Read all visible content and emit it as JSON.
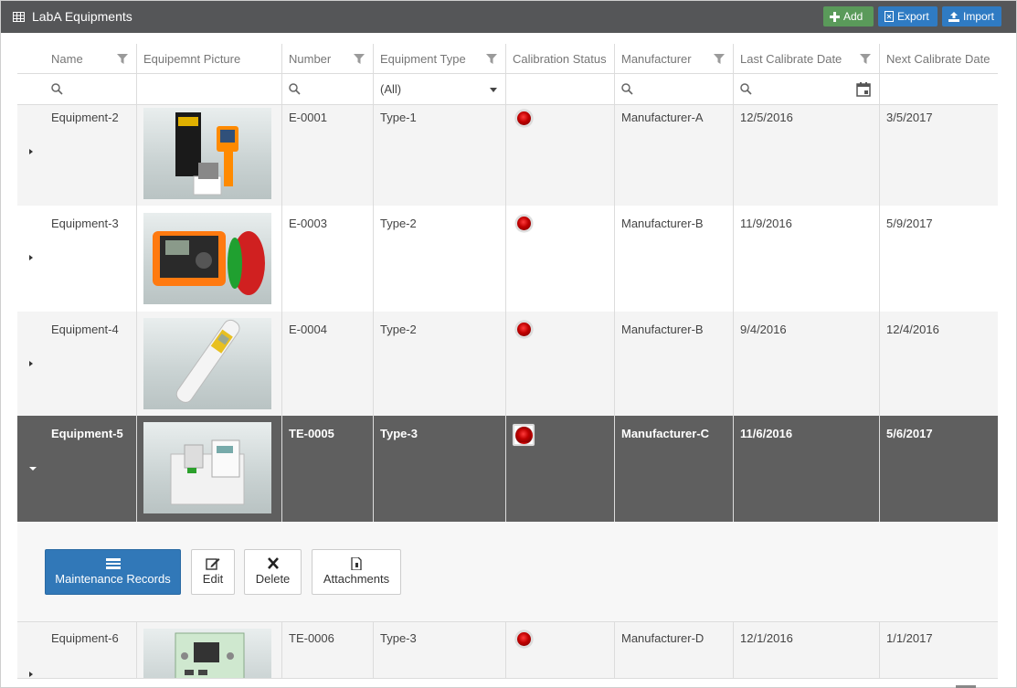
{
  "header": {
    "title": "LabA Equipments",
    "add_label": "Add",
    "export_label": "Export",
    "import_label": "Import"
  },
  "columns": {
    "name": "Name",
    "picture": "Equipemnt Picture",
    "number": "Number",
    "type": "Equipment Type",
    "calibration": "Calibration Status",
    "manufacturer": "Manufacturer",
    "last_date": "Last Calibrate Date",
    "next_date": "Next Calibrate Date"
  },
  "filters": {
    "type_selected": "(All)"
  },
  "rows": [
    {
      "name": "Equipment-2",
      "number": "E-0001",
      "type": "Type-1",
      "manufacturer": "Manufacturer-A",
      "last": "12/5/2016",
      "next": "3/5/2017",
      "status_color": "#d00000"
    },
    {
      "name": "Equipment-3",
      "number": "E-0003",
      "type": "Type-2",
      "manufacturer": "Manufacturer-B",
      "last": "11/9/2016",
      "next": "5/9/2017",
      "status_color": "#d00000"
    },
    {
      "name": "Equipment-4",
      "number": "E-0004",
      "type": "Type-2",
      "manufacturer": "Manufacturer-B",
      "last": "9/4/2016",
      "next": "12/4/2016",
      "status_color": "#d00000"
    },
    {
      "name": "Equipment-5",
      "number": "TE-0005",
      "type": "Type-3",
      "manufacturer": "Manufacturer-C",
      "last": "11/6/2016",
      "next": "5/6/2017",
      "status_color": "#d00000"
    },
    {
      "name": "Equipment-6",
      "number": "TE-0006",
      "type": "Type-3",
      "manufacturer": "Manufacturer-D",
      "last": "12/1/2016",
      "next": "1/1/2017",
      "status_color": "#d00000"
    }
  ],
  "detail": {
    "maintenance_label": "Maintenance Records",
    "edit_label": "Edit",
    "delete_label": "Delete",
    "attachments_label": "Attachments"
  },
  "colors": {
    "header_bg": "#555658",
    "selected_row": "#5f5f5f",
    "primary": "#3178b8",
    "add_green": "#5a9a5a"
  }
}
